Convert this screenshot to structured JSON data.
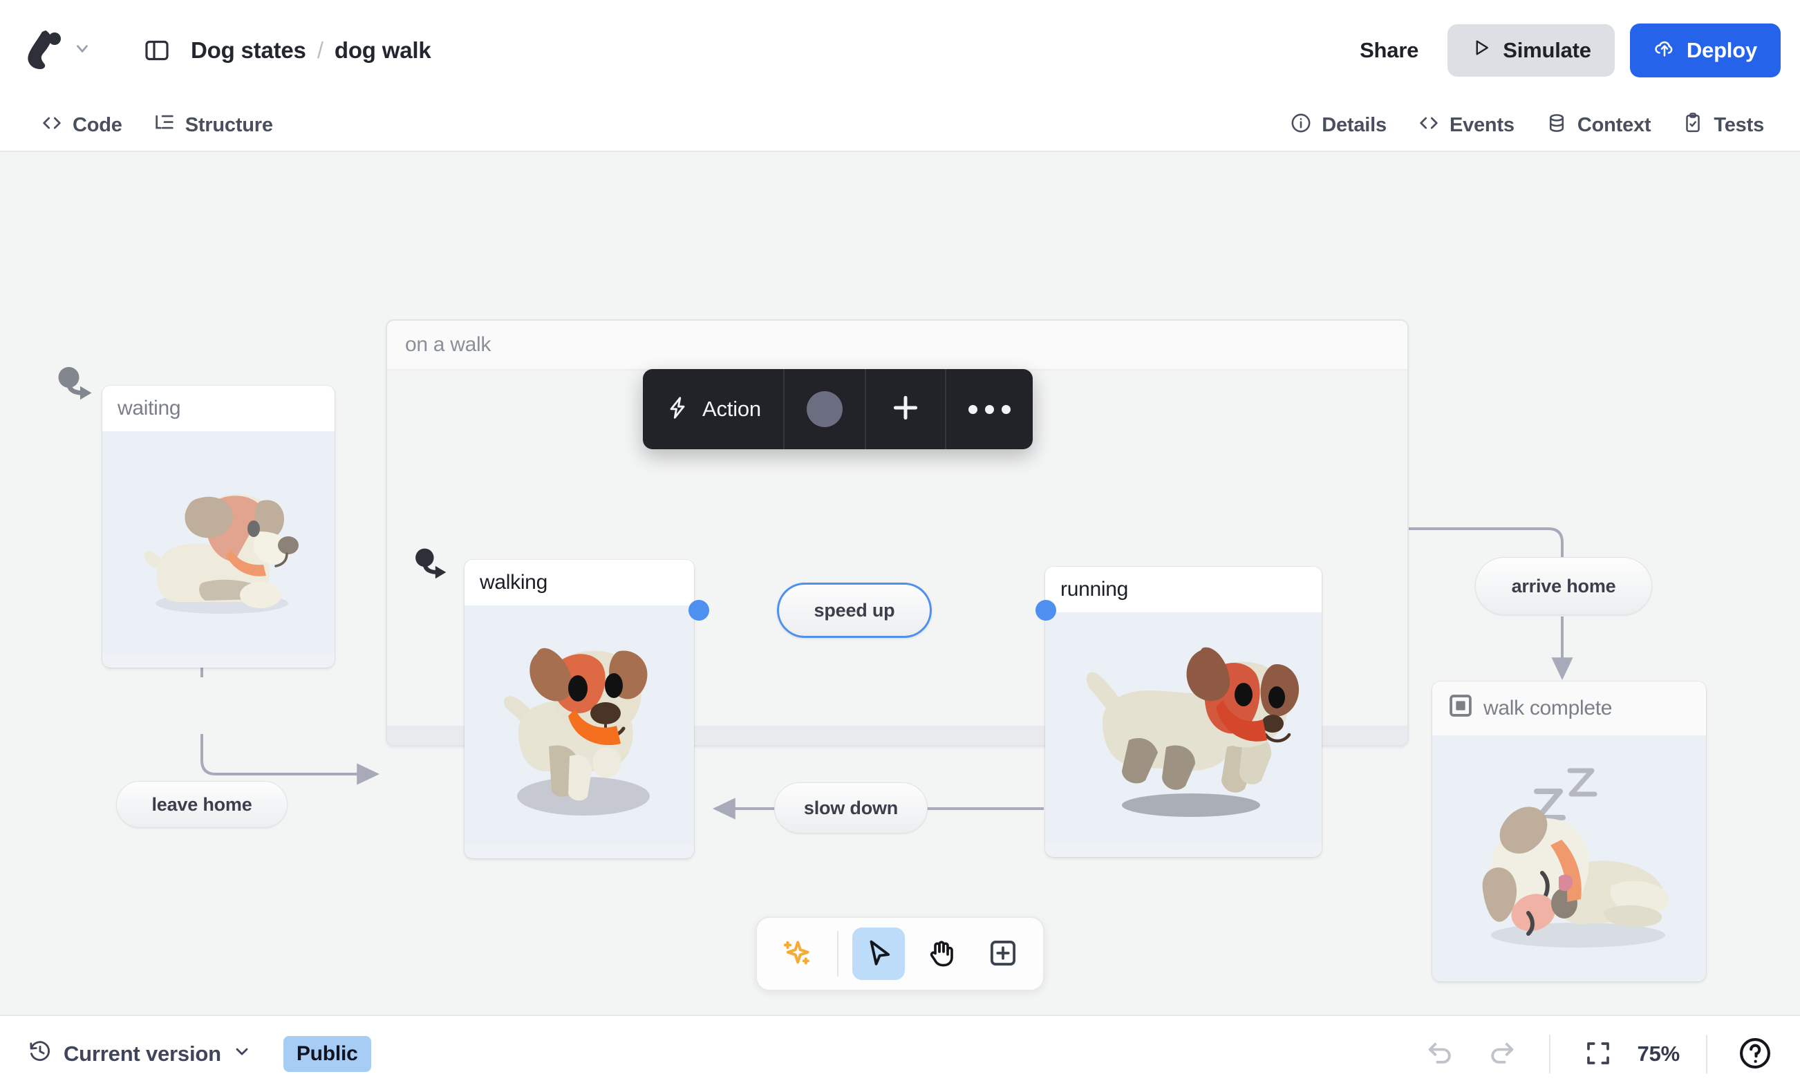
{
  "header": {
    "logo_icon": "stately-logo-icon",
    "logo_chevron_icon": "chevron-down-icon",
    "panel_toggle_icon": "sidebar-panel-icon",
    "breadcrumb": {
      "project": "Dog states",
      "separator": "/",
      "file": "dog walk"
    },
    "share_label": "Share",
    "simulate_label": "Simulate",
    "simulate_icon": "play-icon",
    "deploy_label": "Deploy",
    "deploy_icon": "cloud-upload-icon"
  },
  "tabbar": {
    "left": [
      {
        "label": "Code",
        "icon": "code-brackets-icon"
      },
      {
        "label": "Structure",
        "icon": "tree-structure-icon"
      }
    ],
    "right": [
      {
        "label": "Details",
        "icon": "info-circle-icon"
      },
      {
        "label": "Events",
        "icon": "code-brackets-icon"
      },
      {
        "label": "Context",
        "icon": "database-icon"
      },
      {
        "label": "Tests",
        "icon": "clipboard-check-icon"
      }
    ]
  },
  "action_toolbar": {
    "action_label": "Action",
    "action_icon": "lightning-bolt-icon",
    "color_swatch": "#6a6e80",
    "add_icon": "plus-icon",
    "more_icon": "ellipsis-icon"
  },
  "canvas": {
    "background": "#f3f4f4",
    "states": [
      {
        "id": "waiting",
        "label": "waiting",
        "kind": "atomic",
        "illustration": "dog-sitting"
      },
      {
        "id": "on_a_walk",
        "label": "on a walk",
        "kind": "compound"
      },
      {
        "id": "walking",
        "label": "walking",
        "kind": "atomic",
        "illustration": "dog-walking"
      },
      {
        "id": "running",
        "label": "running",
        "kind": "atomic",
        "illustration": "dog-running"
      },
      {
        "id": "walk_complete",
        "label": "walk complete",
        "kind": "final",
        "icon": "final-state-icon",
        "illustration": "dog-sleeping"
      }
    ],
    "transitions": [
      {
        "id": "leave_home",
        "label": "leave home",
        "from": "waiting",
        "to": "on a walk",
        "selected": false
      },
      {
        "id": "speed_up",
        "label": "speed up",
        "from": "walking",
        "to": "running",
        "selected": true
      },
      {
        "id": "slow_down",
        "label": "slow down",
        "from": "running",
        "to": "walking",
        "selected": false
      },
      {
        "id": "arrive_home",
        "label": "arrive home",
        "from": "on a walk",
        "to": "walk complete",
        "selected": false
      }
    ],
    "accent_handle_color": "#4d90f0",
    "selected_edge_color": "#1b1e26"
  },
  "palette": {
    "tools": [
      {
        "name": "assist-sparkle",
        "icon": "sparkles-icon",
        "active": false
      },
      {
        "name": "select",
        "icon": "cursor-arrow-icon",
        "active": true
      },
      {
        "name": "pan",
        "icon": "hand-icon",
        "active": false
      },
      {
        "name": "add-state",
        "icon": "add-box-icon",
        "active": false
      }
    ]
  },
  "statusbar": {
    "version_label": "Current version",
    "version_icon": "history-clock-icon",
    "version_chevron_icon": "chevron-down-icon",
    "visibility_badge": "Public",
    "undo_icon": "undo-arrow-icon",
    "redo_icon": "redo-arrow-icon",
    "fit_icon": "fit-to-screen-icon",
    "zoom_level": "75%",
    "help_icon": "question-circle-icon"
  }
}
